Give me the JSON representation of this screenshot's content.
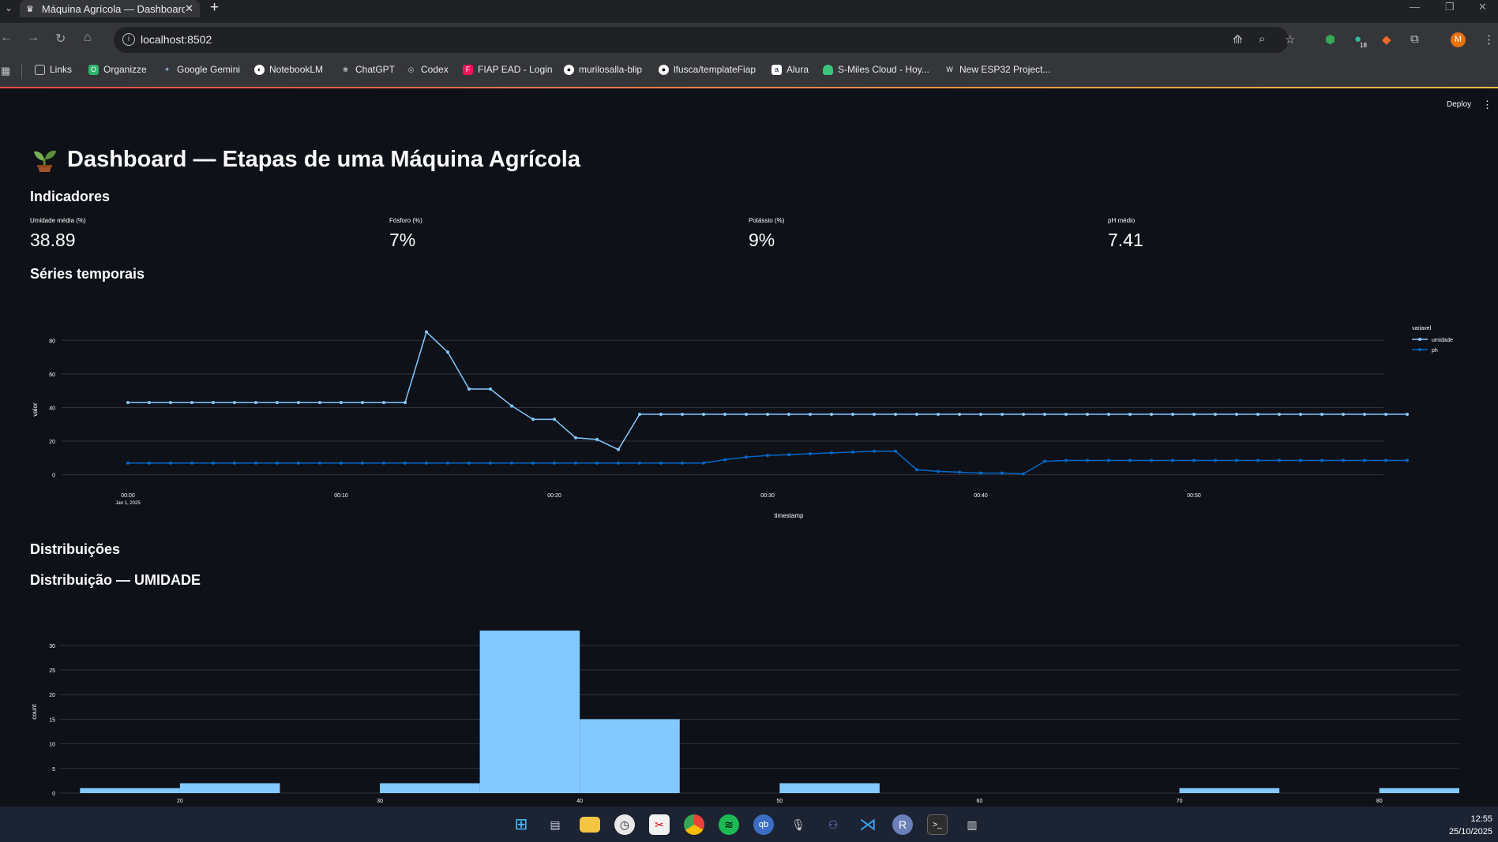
{
  "browser": {
    "tab_title": "Máquina Agrícola — Dashboard",
    "address": "localhost:8502",
    "bookmarks": [
      "Links",
      "Organizze",
      "Google Gemini",
      "NotebookLM",
      "ChatGPT",
      "Codex",
      "FIAP EAD - Login",
      "murilosalla-blip",
      "lfusca/templateFiap",
      "Alura",
      "S-Miles Cloud - Hoy...",
      "New ESP32 Project..."
    ],
    "profile_initial": "M",
    "extension_badge": "18"
  },
  "app": {
    "deploy_label": "Deploy",
    "title": "Dashboard — Etapas de uma Máquina Agrícola",
    "indicators_title": "Indicadores",
    "metrics": [
      {
        "label": "Umidade média (%)",
        "value": "38.89"
      },
      {
        "label": "Fósforo (%)",
        "value": "7%"
      },
      {
        "label": "Potássio (%)",
        "value": "9%"
      },
      {
        "label": "pH médio",
        "value": "7.41"
      }
    ],
    "timeseries_title": "Séries temporais",
    "distributions_title": "Distribuições",
    "hist_title": "Distribuição — UMIDADE"
  },
  "chart_data": [
    {
      "type": "line",
      "xlabel": "timestamp",
      "ylabel": "valor",
      "ylim": [
        -3,
        90
      ],
      "yticks": [
        0,
        20,
        40,
        60,
        80
      ],
      "xticks": [
        "00:00",
        "00:10",
        "00:20",
        "00:30",
        "00:40",
        "00:50"
      ],
      "xtick_sub": "Jan 1, 2025",
      "x_unit": "minutes from Jan 1, 2025 00:00",
      "x": [
        0,
        1,
        2,
        3,
        4,
        5,
        6,
        7,
        8,
        9,
        10,
        11,
        12,
        13,
        14,
        15,
        16,
        17,
        18,
        19,
        20,
        21,
        22,
        23,
        24,
        25,
        26,
        27,
        28,
        29,
        30,
        31,
        32,
        33,
        34,
        35,
        36,
        37,
        38,
        39,
        40,
        41,
        42,
        43,
        44,
        45,
        46,
        47,
        48,
        49,
        50,
        51,
        52,
        53,
        54,
        55,
        56,
        57,
        58,
        59,
        60
      ],
      "legend_title": "variavel",
      "legend_position": "top-right",
      "grid": true,
      "series": [
        {
          "name": "umidade",
          "color": "#83c9ff",
          "values": [
            43,
            43,
            43,
            43,
            43,
            43,
            43,
            43,
            43,
            43,
            43,
            43,
            43,
            43,
            85,
            73,
            51,
            51,
            41,
            33,
            33,
            22,
            21,
            15,
            36,
            36,
            36,
            36,
            36,
            36,
            36,
            36,
            36,
            36,
            36,
            36,
            36,
            36,
            36,
            36,
            36,
            36,
            36,
            36,
            36,
            36,
            36,
            36,
            36,
            36,
            36,
            36,
            36,
            36,
            36,
            36,
            36,
            36,
            36,
            36,
            36
          ]
        },
        {
          "name": "ph",
          "color": "#0068c9",
          "values": [
            7,
            7,
            7,
            7,
            7,
            7,
            7,
            7,
            7,
            7,
            7,
            7,
            7,
            7,
            7,
            7,
            7,
            7,
            7,
            7,
            7,
            7,
            7,
            7,
            7,
            7,
            7,
            7,
            9,
            10.5,
            11.5,
            12,
            12.5,
            13,
            13.5,
            14,
            14,
            3,
            2,
            1.5,
            1,
            1,
            0.5,
            8,
            8.5,
            8.5,
            8.5,
            8.5,
            8.5,
            8.5,
            8.5,
            8.5,
            8.5,
            8.5,
            8.5,
            8.5,
            8.5,
            8.5,
            8.5,
            8.5,
            8.5
          ]
        }
      ]
    },
    {
      "type": "bar",
      "subtype": "histogram",
      "xlabel": "",
      "ylabel": "count",
      "xlim": [
        14,
        84
      ],
      "ylim": [
        0,
        33.5
      ],
      "xticks": [
        20,
        30,
        40,
        50,
        60,
        70,
        80
      ],
      "yticks": [
        0,
        5,
        10,
        15,
        20,
        25,
        30
      ],
      "bin_width": 5,
      "bins": [
        15,
        20,
        25,
        30,
        35,
        40,
        45,
        50,
        55,
        60,
        65,
        70,
        75,
        80
      ],
      "values": [
        1,
        2,
        0,
        2,
        33,
        15,
        0,
        2,
        0,
        0,
        0,
        1,
        0,
        1
      ],
      "color": "#83c9ff"
    }
  ],
  "taskbar": {
    "time": "12:55",
    "date": "25/10/2025"
  }
}
